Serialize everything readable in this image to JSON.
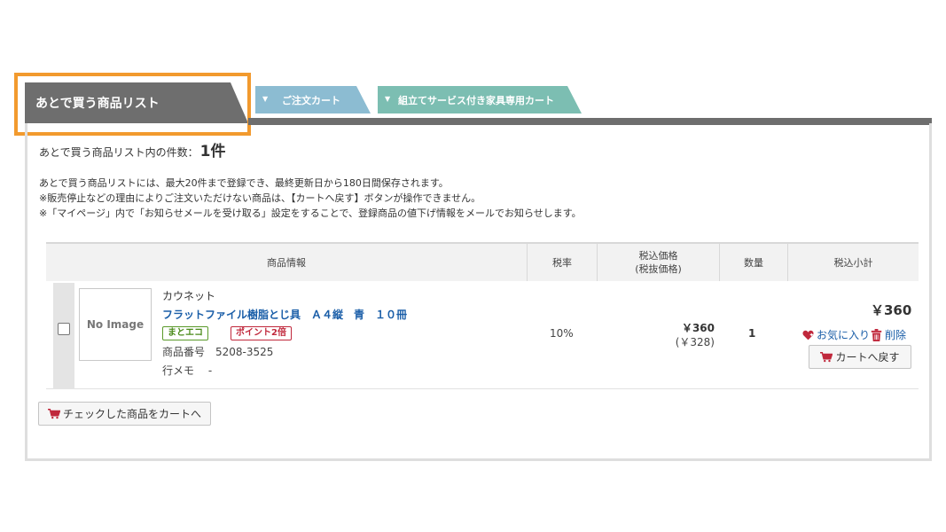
{
  "tabs": {
    "active": "あとで買う商品リスト",
    "order_cart": "ご注文カート",
    "furniture_cart": "組立てサービス付き家具専用カート",
    "arrow": "▼"
  },
  "summary": {
    "label": "あとで買う商品リスト内の件数：",
    "count": "1件"
  },
  "info_lines": [
    "あとで買う商品リストには、最大20件まで登録でき、最終更新日から180日間保存されます。",
    "※販売停止などの理由によりご注文いただけない商品は、【カートへ戻す】ボタンが操作できません。",
    "※「マイページ」内で「お知らせメールを受け取る」設定をすることで、登録商品の値下げ情報をメールでお知らせします。"
  ],
  "table": {
    "headers": {
      "product": "商品情報",
      "tax_rate": "税率",
      "price_line1": "税込価格",
      "price_line2": "(税抜価格)",
      "qty": "数量",
      "subtotal": "税込小計"
    },
    "rows": [
      {
        "image_placeholder": "No Image",
        "brand": "カウネット",
        "name": "フラットファイル樹脂とじ具　Ａ４縦　青　１０冊",
        "badge_eco": "まとエコ",
        "badge_point": "ポイント2倍",
        "product_no": "商品番号　5208-3525",
        "memo": "行メモ　 -",
        "tax_rate": "10%",
        "price": "￥360",
        "price_ex": "(￥328)",
        "qty": "1",
        "subtotal": "￥360",
        "fav_label": "お気に入り",
        "delete_label": "削除",
        "back_label": "カートへ戻す"
      }
    ]
  },
  "buttons": {
    "add_checked": "チェックした商品をカートへ"
  },
  "colors": {
    "highlight": "#f29a2e",
    "tab_active": "#6e6e6e",
    "tab_order": "#8cbcd2",
    "tab_furniture": "#7cbeb2",
    "link": "#1a5ea8",
    "accent_red": "#c0283c"
  }
}
